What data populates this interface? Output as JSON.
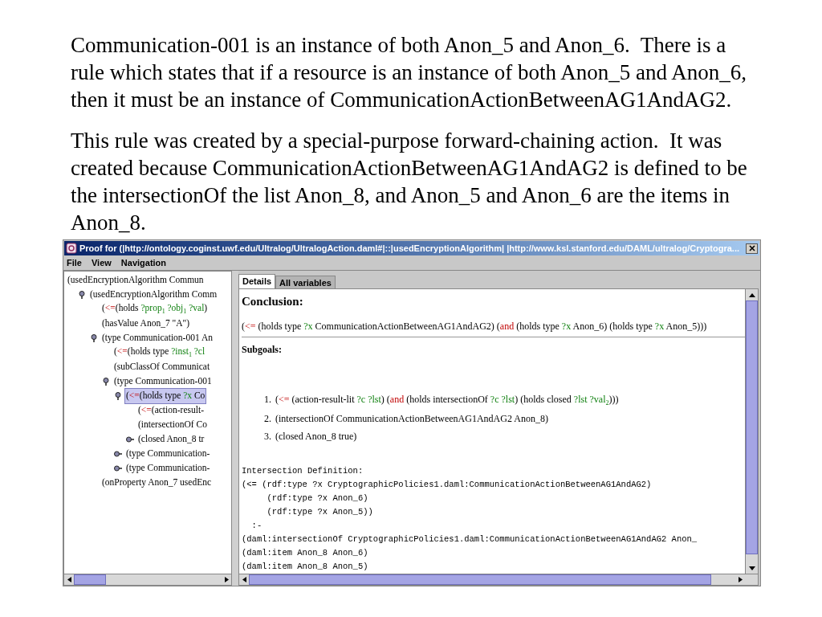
{
  "slide": {
    "paragraphs": [
      "Communication-001 is an instance of both Anon_5 and Anon_6.  There is a rule which states that if a resource is an instance of both Anon_5 and Anon_6, then it must be an instance of CommunicationActionBetweenAG1AndAG2.",
      "This rule was created by a special-purpose forward-chaining action.  It was created because CommunicationActionBetweenAG1AndAG2 is defined to be the intersectionOf the list Anon_8, and Anon_5 and Anon_6 are the items in Anon_8."
    ]
  },
  "window": {
    "title": "Proof for (|http://ontology.coginst.uwf.edu/Ultralog/UltralogAction.daml#|::|usedEncryptionAlgorithm| |http://www.ksl.stanford.edu/DAML/ultralog/Cryptogra...",
    "menu": [
      "File",
      "View",
      "Navigation"
    ],
    "tree": [
      {
        "parts": [
          "(usedEncryptionAlgorithm Commun"
        ],
        "selected": false,
        "children": [
          {
            "parts": [
              "(usedEncryptionAlgorithm Comm"
            ],
            "expanded": true,
            "selected": false,
            "children": [
              {
                "parts": [
                  "(",
                  {
                    "kind": "op",
                    "text": "<="
                  },
                  "(holds ",
                  {
                    "kind": "var",
                    "text": "?prop"
                  },
                  {
                    "kind": "sub",
                    "text": "1"
                  },
                  {
                    "kind": "var",
                    "text": " ?obj"
                  },
                  {
                    "kind": "sub",
                    "text": "1"
                  },
                  {
                    "kind": "var",
                    "text": " ?val"
                  },
                  ")"
                ],
                "selected": false
              },
              {
                "parts": [
                  "(hasValue Anon_7 \"A\")"
                ],
                "selected": false
              },
              {
                "parts": [
                  "(type Communication-001 An"
                ],
                "expanded": true,
                "selected": false,
                "children": [
                  {
                    "parts": [
                      "(",
                      {
                        "kind": "op",
                        "text": "<="
                      },
                      "(holds type ",
                      {
                        "kind": "var",
                        "text": "?inst"
                      },
                      {
                        "kind": "sub",
                        "text": "1"
                      },
                      {
                        "kind": "var",
                        "text": " ?cl"
                      }
                    ],
                    "selected": false
                  },
                  {
                    "parts": [
                      "(subClassOf Communicat"
                    ],
                    "selected": false
                  },
                  {
                    "parts": [
                      "(type Communication-001"
                    ],
                    "expanded": true,
                    "selected": false,
                    "children": [
                      {
                        "parts": [
                          "(",
                          {
                            "kind": "op",
                            "text": "<="
                          },
                          "(holds type ",
                          {
                            "kind": "var",
                            "text": "?x"
                          },
                          " Co"
                        ],
                        "expanded": true,
                        "selected": true,
                        "children": [
                          {
                            "parts": [
                              "(",
                              {
                                "kind": "op",
                                "text": "<="
                              },
                              "(action-result-"
                            ],
                            "selected": false
                          },
                          {
                            "parts": [
                              "(intersectionOf Co"
                            ],
                            "selected": false
                          },
                          {
                            "parts": [
                              "(closed Anon_8 tr"
                            ],
                            "expanded": false,
                            "selected": false
                          }
                        ]
                      },
                      {
                        "parts": [
                          "(type Communication-"
                        ],
                        "expanded": false,
                        "selected": false
                      },
                      {
                        "parts": [
                          "(type Communication-"
                        ],
                        "expanded": false,
                        "selected": false
                      }
                    ]
                  }
                ]
              },
              {
                "parts": [
                  "(onProperty Anon_7 usedEnc"
                ],
                "selected": false
              }
            ]
          }
        ]
      }
    ],
    "tabs": [
      {
        "label": "Details",
        "selected": true
      },
      {
        "label": "All variables",
        "selected": false
      }
    ],
    "conclusion": {
      "heading": "Conclusion:",
      "parts": [
        "(",
        {
          "kind": "op",
          "text": "<="
        },
        " (holds type ",
        {
          "kind": "var",
          "text": "?x"
        },
        " CommunicationActionBetweenAG1AndAG2) (",
        {
          "kind": "op",
          "text": "and"
        },
        " (holds type ",
        {
          "kind": "var",
          "text": "?x"
        },
        " Anon_6) (holds type ",
        {
          "kind": "var",
          "text": "?x"
        },
        " Anon_5)))"
      ]
    },
    "subgoals": {
      "heading": "Subgoals:",
      "items": [
        {
          "number": "1.",
          "parts": [
            "(",
            {
              "kind": "op",
              "text": "<="
            },
            " (action-result-lit ",
            {
              "kind": "var",
              "text": "?c ?lst"
            },
            ") (",
            {
              "kind": "op",
              "text": "and"
            },
            " (holds intersectionOf ",
            {
              "kind": "var",
              "text": "?c ?lst"
            },
            ") (holds closed ",
            {
              "kind": "var",
              "text": "?lst ?val"
            },
            {
              "kind": "sub",
              "text": "2"
            },
            ")))"
          ]
        },
        {
          "number": "2.",
          "parts": [
            "(intersectionOf CommunicationActionBetweenAG1AndAG2 Anon_8)"
          ]
        },
        {
          "number": "3.",
          "parts": [
            "(closed Anon_8 true)"
          ]
        }
      ]
    },
    "definition": [
      "Intersection Definition:",
      "(<= (rdf:type ?x CryptographicPolicies1.daml:CommunicationActionBetweenAG1AndAG2)",
      "     (rdf:type ?x Anon_6)",
      "     (rdf:type ?x Anon_5))",
      "  :-",
      "(daml:intersectionOf CryptographicPolicies1.daml:CommunicationActionBetweenAG1AndAG2 Anon_",
      "(daml:item Anon_8 Anon_6)",
      "(daml:item Anon_8 Anon_5)"
    ]
  }
}
